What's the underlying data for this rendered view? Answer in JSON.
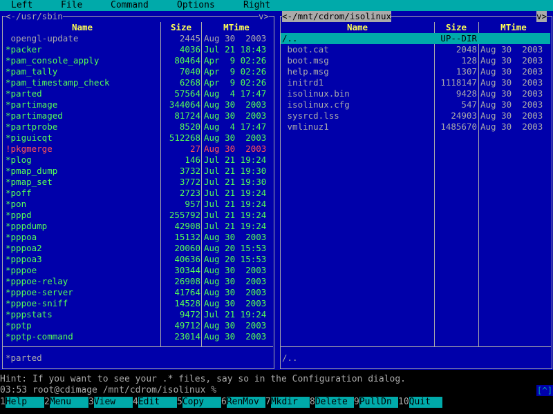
{
  "menubar": {
    "items": [
      "Left",
      "File",
      "Command",
      "Options",
      "Right"
    ]
  },
  "left_panel": {
    "title": "<-/usr/sbin",
    "toggle": "v>",
    "columns": [
      "Name",
      "Size",
      "MTime"
    ],
    "files": [
      {
        "name": " opengl-update",
        "size": "2445",
        "mtime": "Aug 30  2003",
        "kind": "reg"
      },
      {
        "name": "*packer",
        "size": "4036",
        "mtime": "Jul 21 18:43",
        "kind": "exec"
      },
      {
        "name": "*pam_console_apply",
        "size": "80464",
        "mtime": "Apr  9 02:26",
        "kind": "exec"
      },
      {
        "name": "*pam_tally",
        "size": "7040",
        "mtime": "Apr  9 02:26",
        "kind": "exec"
      },
      {
        "name": "*pam_timestamp_check",
        "size": "6268",
        "mtime": "Apr  9 02:26",
        "kind": "exec"
      },
      {
        "name": "*parted",
        "size": "57564",
        "mtime": "Aug  4 17:47",
        "kind": "exec"
      },
      {
        "name": "*partimage",
        "size": "344064",
        "mtime": "Aug 30  2003",
        "kind": "exec"
      },
      {
        "name": "*partimaged",
        "size": "81724",
        "mtime": "Aug 30  2003",
        "kind": "exec"
      },
      {
        "name": "*partprobe",
        "size": "8520",
        "mtime": "Aug  4 17:47",
        "kind": "exec"
      },
      {
        "name": "*piguicqt",
        "size": "512268",
        "mtime": "Aug 30  2003",
        "kind": "exec"
      },
      {
        "name": "!pkgmerge",
        "size": "27",
        "mtime": "Aug 30  2003",
        "kind": "warn"
      },
      {
        "name": "*plog",
        "size": "146",
        "mtime": "Jul 21 19:24",
        "kind": "exec"
      },
      {
        "name": "*pmap_dump",
        "size": "3732",
        "mtime": "Jul 21 19:30",
        "kind": "exec"
      },
      {
        "name": "*pmap_set",
        "size": "3772",
        "mtime": "Jul 21 19:30",
        "kind": "exec"
      },
      {
        "name": "*poff",
        "size": "2723",
        "mtime": "Jul 21 19:24",
        "kind": "exec"
      },
      {
        "name": "*pon",
        "size": "957",
        "mtime": "Jul 21 19:24",
        "kind": "exec"
      },
      {
        "name": "*pppd",
        "size": "255792",
        "mtime": "Jul 21 19:24",
        "kind": "exec"
      },
      {
        "name": "*pppdump",
        "size": "42908",
        "mtime": "Jul 21 19:24",
        "kind": "exec"
      },
      {
        "name": "*pppoa",
        "size": "15132",
        "mtime": "Aug 30  2003",
        "kind": "exec"
      },
      {
        "name": "*pppoa2",
        "size": "20060",
        "mtime": "Aug 20 15:53",
        "kind": "exec"
      },
      {
        "name": "*pppoa3",
        "size": "40636",
        "mtime": "Aug 20 15:53",
        "kind": "exec"
      },
      {
        "name": "*pppoe",
        "size": "30344",
        "mtime": "Aug 30  2003",
        "kind": "exec"
      },
      {
        "name": "*pppoe-relay",
        "size": "26908",
        "mtime": "Aug 30  2003",
        "kind": "exec"
      },
      {
        "name": "*pppoe-server",
        "size": "41764",
        "mtime": "Aug 30  2003",
        "kind": "exec"
      },
      {
        "name": "*pppoe-sniff",
        "size": "14528",
        "mtime": "Aug 30  2003",
        "kind": "exec"
      },
      {
        "name": "*pppstats",
        "size": "9472",
        "mtime": "Jul 21 19:24",
        "kind": "exec"
      },
      {
        "name": "*pptp",
        "size": "49712",
        "mtime": "Aug 30  2003",
        "kind": "exec"
      },
      {
        "name": "*pptp-command",
        "size": "23014",
        "mtime": "Aug 30  2003",
        "kind": "exec"
      }
    ],
    "status": "*parted"
  },
  "right_panel": {
    "title": "<-/mnt/cdrom/isolinux",
    "toggle": "v>",
    "columns": [
      "Name",
      "Size",
      "MTime"
    ],
    "files": [
      {
        "name": "/..",
        "size": "UP--DIR",
        "mtime": "",
        "kind": "updir"
      },
      {
        "name": " boot.cat",
        "size": "2048",
        "mtime": "Aug 30  2003",
        "kind": "reg"
      },
      {
        "name": " boot.msg",
        "size": "128",
        "mtime": "Aug 30  2003",
        "kind": "reg"
      },
      {
        "name": " help.msg",
        "size": "1307",
        "mtime": "Aug 30  2003",
        "kind": "reg"
      },
      {
        "name": " initrd1",
        "size": "1118147",
        "mtime": "Aug 30  2003",
        "kind": "reg"
      },
      {
        "name": " isolinux.bin",
        "size": "9428",
        "mtime": "Aug 30  2003",
        "kind": "reg"
      },
      {
        "name": " isolinux.cfg",
        "size": "547",
        "mtime": "Aug 30  2003",
        "kind": "reg"
      },
      {
        "name": " sysrcd.lss",
        "size": "24903",
        "mtime": "Aug 30  2003",
        "kind": "reg"
      },
      {
        "name": " vmlinuz1",
        "size": "1485670",
        "mtime": "Aug 30  2003",
        "kind": "reg"
      }
    ],
    "status": "/.."
  },
  "hint": "Hint: If you want to see your .* files, say so in the Configuration dialog.",
  "prompt": {
    "text": "03:53 root@cdimage /mnt/cdrom/isolinux %",
    "button": "[^]"
  },
  "fkeys": [
    {
      "num": "1",
      "label": "Help"
    },
    {
      "num": "2",
      "label": "Menu"
    },
    {
      "num": "3",
      "label": "View"
    },
    {
      "num": "4",
      "label": "Edit"
    },
    {
      "num": "5",
      "label": "Copy"
    },
    {
      "num": "6",
      "label": "RenMov"
    },
    {
      "num": "7",
      "label": "Mkdir"
    },
    {
      "num": "8",
      "label": "Delete"
    },
    {
      "num": "9",
      "label": "PullDn"
    },
    {
      "num": "10",
      "label": "Quit"
    }
  ],
  "colors": {
    "panel_bg": "#0000aa",
    "menubar_bg": "#00aaaa",
    "header_fg": "#ffff55",
    "exec_fg": "#55ff55",
    "warn_fg": "#ff5555"
  }
}
